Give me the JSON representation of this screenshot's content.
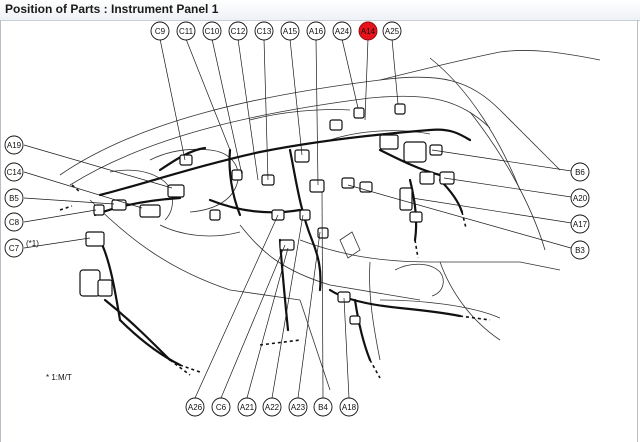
{
  "header": {
    "title": "Position of Parts : Instrument Panel 1"
  },
  "callouts": {
    "top": [
      "C9",
      "C11",
      "C10",
      "C12",
      "C13",
      "A15",
      "A16",
      "A24",
      "A14",
      "A25"
    ],
    "left": [
      "A19",
      "C14",
      "B5",
      "C8",
      "C7"
    ],
    "right": [
      "B6",
      "A20",
      "A17",
      "B3"
    ],
    "bottom": [
      "A26",
      "C6",
      "A21",
      "A22",
      "A23",
      "B4",
      "A18"
    ]
  },
  "highlighted_callout": "A14",
  "colors": {
    "highlight": "#e8121b",
    "line": "#1a1a1a",
    "harness": "#111111"
  },
  "annotations": {
    "star_mark": "(*1)",
    "footnote": "* 1:M/T"
  }
}
